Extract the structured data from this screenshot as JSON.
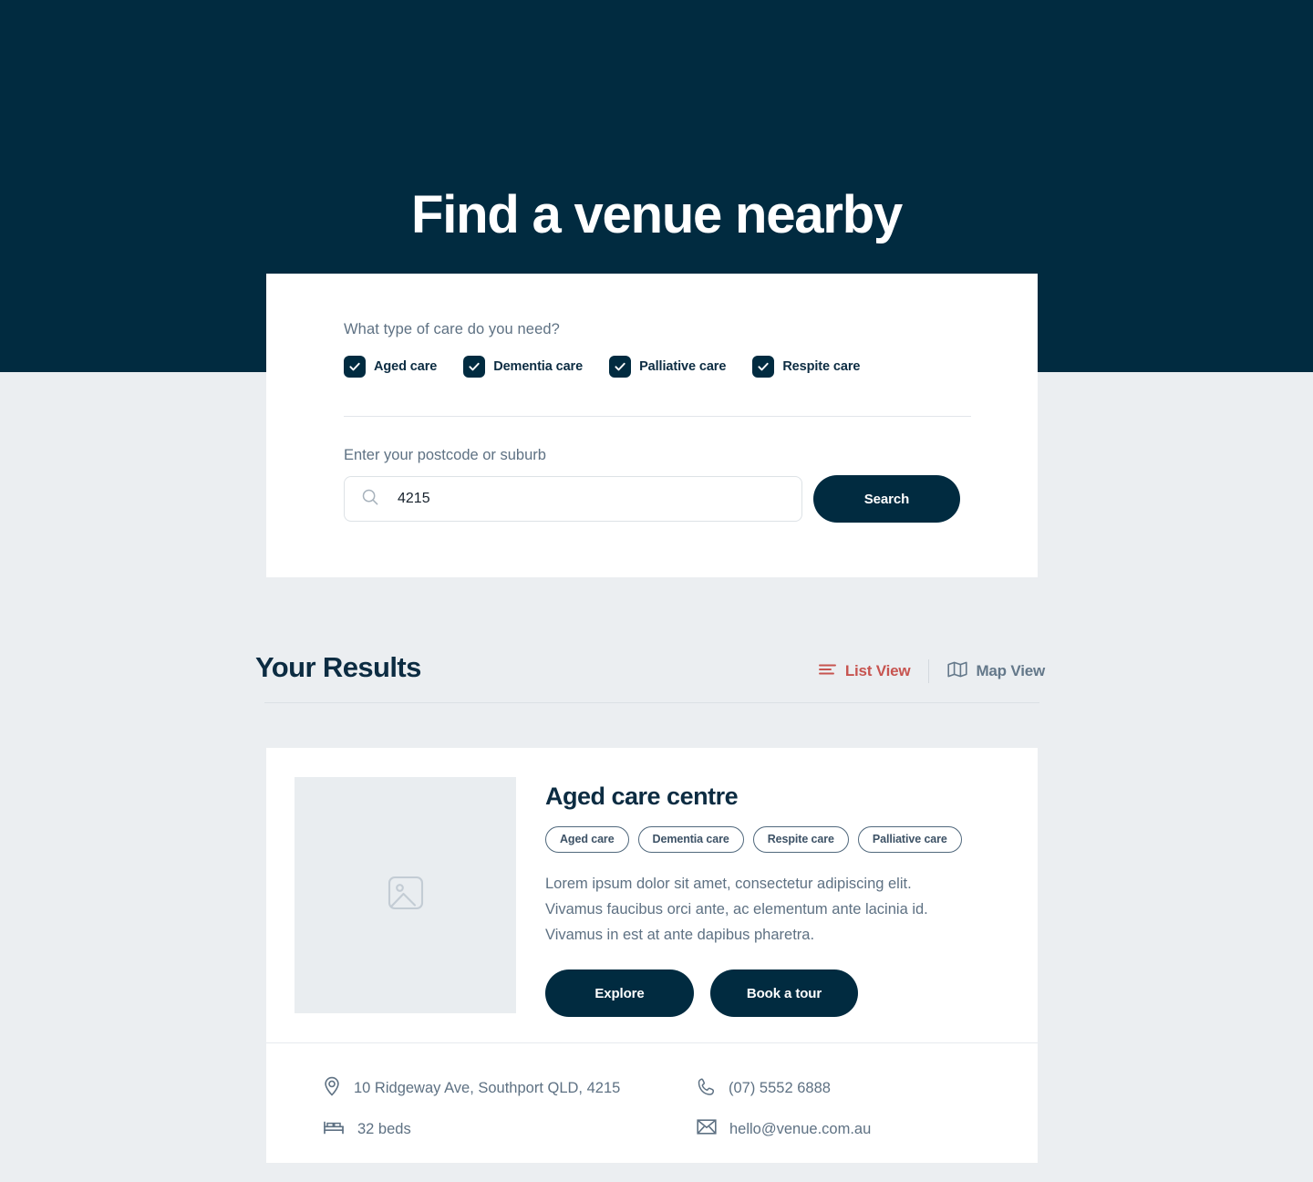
{
  "hero": {
    "title": "Find a venue nearby",
    "bg_color": "#012b40"
  },
  "search_panel": {
    "care_question": "What type of care do you need?",
    "care_options": [
      {
        "label": "Aged care",
        "checked": true
      },
      {
        "label": "Dementia care",
        "checked": true
      },
      {
        "label": "Palliative care",
        "checked": true
      },
      {
        "label": "Respite care",
        "checked": true
      }
    ],
    "postcode_label": "Enter your postcode or suburb",
    "postcode_value": "4215",
    "postcode_placeholder": "Enter your postcode or suburb",
    "search_icon": "search-icon",
    "search_button": "Search"
  },
  "results": {
    "title": "Your Results",
    "views": [
      {
        "label": "List View",
        "icon": "list-icon",
        "active": true,
        "color": "#c75450"
      },
      {
        "label": "Map View",
        "icon": "map-icon",
        "active": false,
        "color": "#64788a"
      }
    ]
  },
  "venue": {
    "thumb_icon": "image-placeholder-icon",
    "name": "Aged care centre",
    "tags": [
      "Aged care",
      "Dementia care",
      "Respite care",
      "Palliative care"
    ],
    "description": "Lorem ipsum dolor sit amet, consectetur adipiscing elit. Vivamus faucibus orci ante, ac elementum ante lacinia id. Vivamus in est at ante dapibus pharetra.",
    "actions": [
      {
        "label": "Explore"
      },
      {
        "label": "Book a tour"
      }
    ],
    "meta": {
      "address": "10 Ridgeway Ave, Southport QLD, 4215",
      "phone": "(07) 5552 6888",
      "beds": "32 beds",
      "email": "hello@venue.com.au"
    }
  }
}
